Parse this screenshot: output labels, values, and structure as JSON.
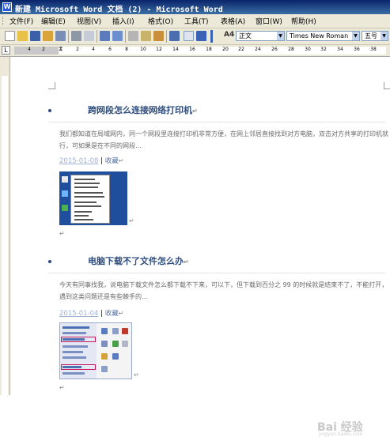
{
  "window": {
    "title": "新建 Microsoft Word 文档 (2) - Microsoft Word",
    "app_icon": "W"
  },
  "menu": [
    {
      "label": "文件(F)"
    },
    {
      "label": "编辑(E)"
    },
    {
      "label": "视图(V)"
    },
    {
      "label": "插入(I)"
    },
    {
      "label": "格式(O)"
    },
    {
      "label": "工具(T)"
    },
    {
      "label": "表格(A)"
    },
    {
      "label": "窗口(W)"
    },
    {
      "label": "帮助(H)"
    }
  ],
  "toolbar": {
    "style_value": "正文",
    "font_value": "Times New Roman",
    "size_value": "五号",
    "style_icon": "A4"
  },
  "ruler": {
    "tab_selector": "L",
    "ticks": [
      "4",
      "2",
      "2",
      "4",
      "6",
      "8",
      "10",
      "12",
      "14",
      "16",
      "18",
      "20",
      "22",
      "24",
      "26",
      "28",
      "30",
      "32",
      "34",
      "36",
      "38"
    ]
  },
  "document": {
    "articles": [
      {
        "heading": "跨网段怎么连接网络打印机",
        "paragraph": "我们都知道在局域网内，同一个网段里连接打印机非常方便，在网上邻居直接找到对方电脑，双击对方共享的打印机就行，可如果是在不同的网段…",
        "date": "2015-01-08",
        "separator": "|",
        "collect": "收藏",
        "mark": "↵",
        "image_label": "context menu screenshot",
        "menu_lines": 13
      },
      {
        "heading": "电脑下载不了文件怎么办",
        "paragraph": "今天有同事找我，说电脑下载文件怎么都下载不下来，可以下，但下载到百分之 99 的时候就是结束不了，不能打开，遇到这类问题还是有些棘手的…",
        "date": "2015-01-04",
        "separator": "|",
        "collect": "收藏",
        "mark": "↵",
        "image_label": "settings window screenshot"
      }
    ],
    "paragraph_mark": "↵",
    "watermark": "Bai 经验",
    "watermark_sub": "jingyan.baidu.com"
  },
  "colors": {
    "titlebar": "#0a246a",
    "heading": "#2e4d7e",
    "date_link": "#9fb3d3",
    "collect_link": "#4f6fa5",
    "chrome": "#ece9d8"
  },
  "icons": [
    "new-doc-icon",
    "open-icon",
    "save-icon",
    "permission-icon",
    "email-icon",
    "print-icon",
    "print-preview-icon",
    "spelling-icon",
    "research-icon",
    "cut-icon",
    "copy-icon",
    "paste-icon",
    "undo-icon",
    "ink-icon"
  ]
}
